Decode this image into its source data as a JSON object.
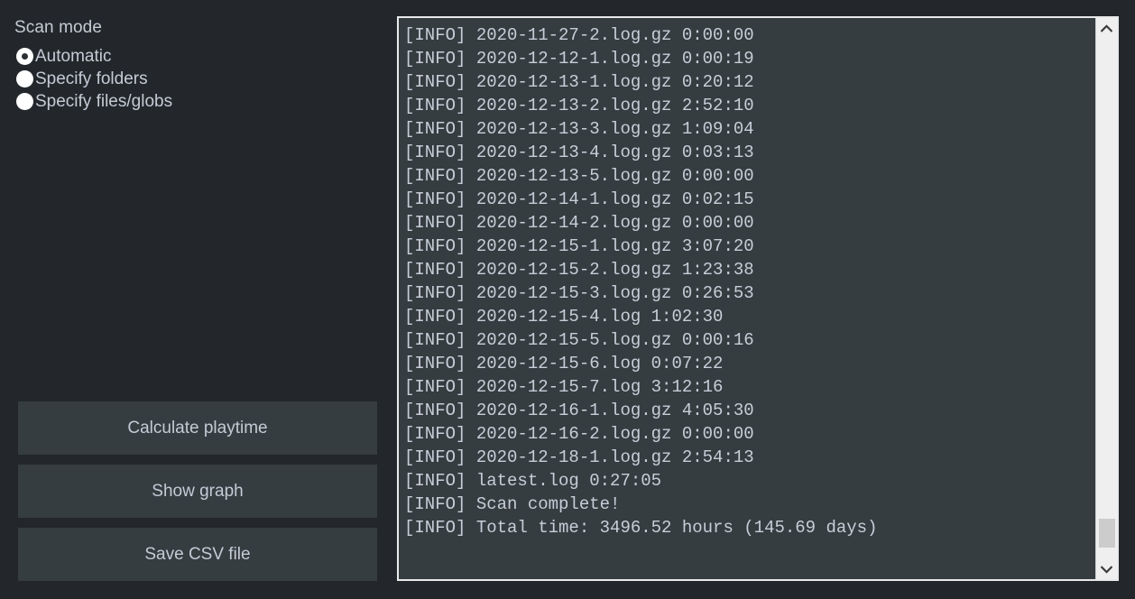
{
  "left": {
    "scan_mode_label": "Scan mode",
    "radio_options": [
      {
        "label": "Automatic",
        "selected": true
      },
      {
        "label": "Specify folders",
        "selected": false
      },
      {
        "label": "Specify files/globs",
        "selected": false
      }
    ],
    "buttons": [
      {
        "label": "Calculate playtime"
      },
      {
        "label": "Show graph"
      },
      {
        "label": "Save CSV file"
      }
    ]
  },
  "log": {
    "lines": [
      "[INFO] 2020-11-27-2.log.gz 0:00:00",
      "[INFO] 2020-12-12-1.log.gz 0:00:19",
      "[INFO] 2020-12-13-1.log.gz 0:20:12",
      "[INFO] 2020-12-13-2.log.gz 2:52:10",
      "[INFO] 2020-12-13-3.log.gz 1:09:04",
      "[INFO] 2020-12-13-4.log.gz 0:03:13",
      "[INFO] 2020-12-13-5.log.gz 0:00:00",
      "[INFO] 2020-12-14-1.log.gz 0:02:15",
      "[INFO] 2020-12-14-2.log.gz 0:00:00",
      "[INFO] 2020-12-15-1.log.gz 3:07:20",
      "[INFO] 2020-12-15-2.log.gz 1:23:38",
      "[INFO] 2020-12-15-3.log.gz 0:26:53",
      "[INFO] 2020-12-15-4.log 1:02:30",
      "[INFO] 2020-12-15-5.log.gz 0:00:16",
      "[INFO] 2020-12-15-6.log 0:07:22",
      "[INFO] 2020-12-15-7.log 3:12:16",
      "[INFO] 2020-12-16-1.log.gz 4:05:30",
      "[INFO] 2020-12-16-2.log.gz 0:00:00",
      "[INFO] 2020-12-18-1.log.gz 2:54:13",
      "[INFO] latest.log 0:27:05",
      "[INFO] Scan complete!",
      "[INFO] Total time: 3496.52 hours (145.69 days)"
    ]
  },
  "scrollbar": {
    "up_arrow_icon": "chevron-up-icon",
    "down_arrow_icon": "chevron-down-icon"
  },
  "colors": {
    "window_background": "#23272b",
    "panel_background": "#353d41",
    "text": "#c5cbd6",
    "log_text": "#c8ced8",
    "scrollbar_track": "#efefef",
    "scrollbar_thumb": "#cccccc",
    "panel_border": "#e9e9ea"
  }
}
